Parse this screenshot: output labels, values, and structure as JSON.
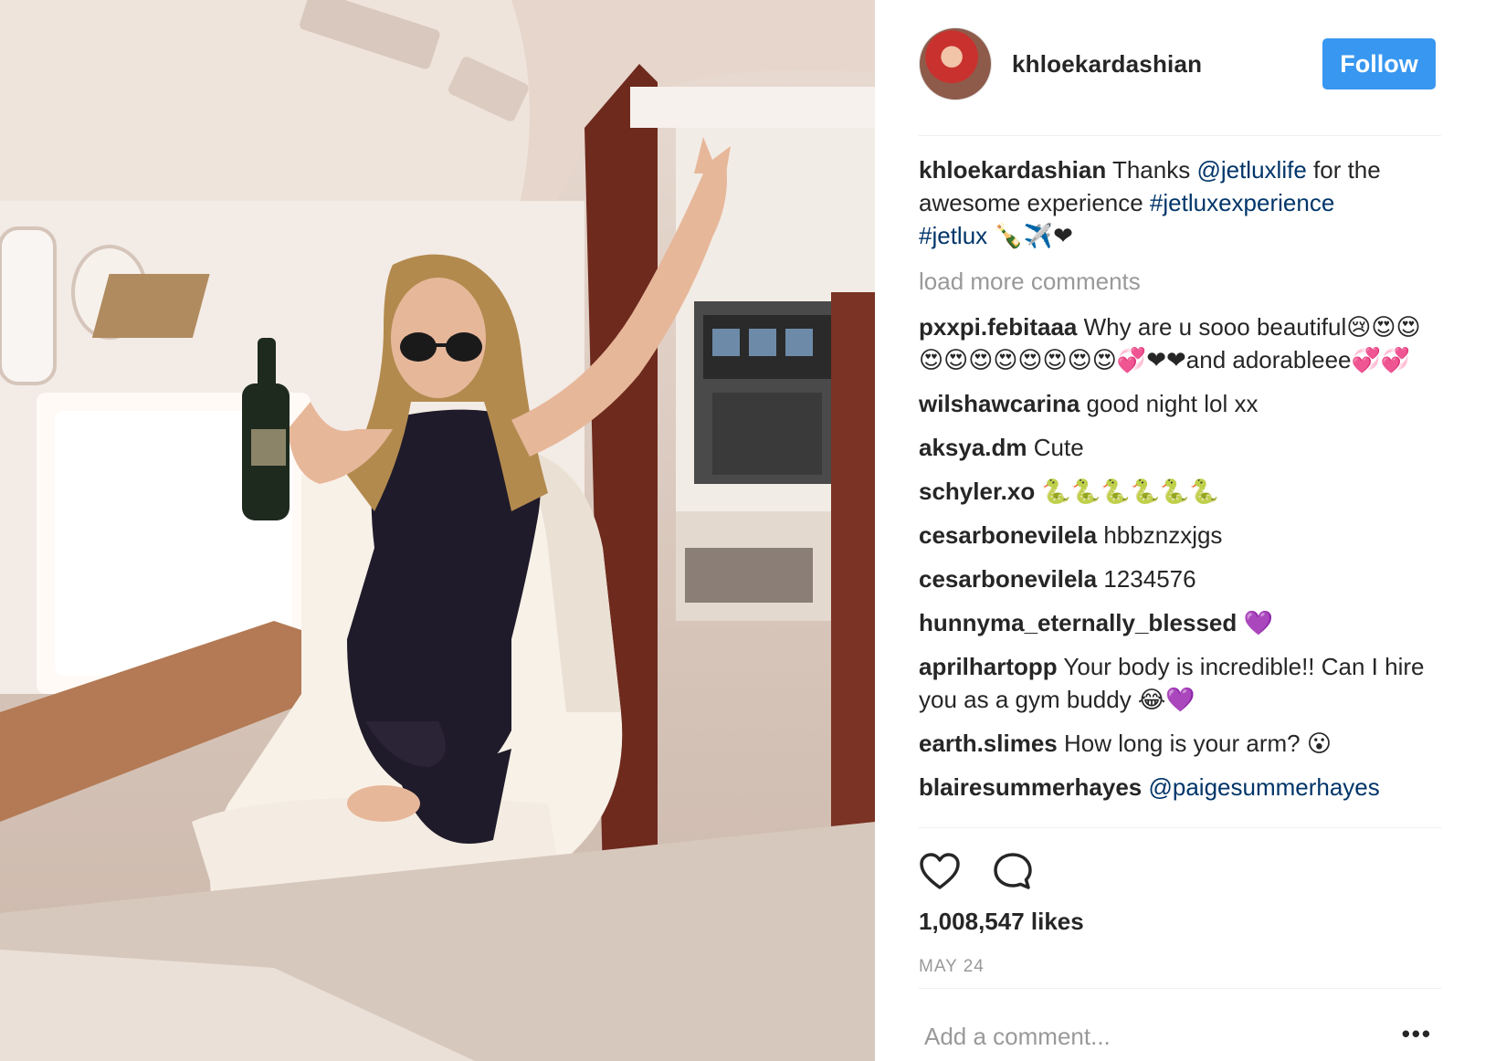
{
  "post": {
    "username": "khloekardashian",
    "follow_label": "Follow",
    "caption": {
      "user": "khloekardashian",
      "text_1": " Thanks ",
      "mention": "@jetluxlife",
      "text_2": " for the awesome experience ",
      "hashtag_1": "#jetluxexperience",
      "hashtag_2": "#jetlux",
      "emoji": " 🍾✈️❤"
    },
    "load_more_label": "load more comments",
    "comments": [
      {
        "user": "pxxpi.febitaaa",
        "text": " Why are u sooo beautiful😢😍😍😍😍😍😍😍😍😍😍💞❤❤and adorableee💞💞"
      },
      {
        "user": "wilshawcarina",
        "text": " good night lol xx"
      },
      {
        "user": "aksya.dm",
        "text": " Cute"
      },
      {
        "user": "schyler.xo",
        "text": " 🐍🐍🐍🐍🐍🐍"
      },
      {
        "user": "cesarbonevilela",
        "text": " hbbznzxjgs"
      },
      {
        "user": "cesarbonevilela",
        "text": " 1234576"
      },
      {
        "user": "hunnyma_eternally_blessed",
        "text": " 💜"
      },
      {
        "user": "aprilhartopp",
        "text": " Your body is incredible!! Can I hire you as a gym buddy 😂💜"
      },
      {
        "user": "earth.slimes",
        "text": " How long is your arm? 😮"
      },
      {
        "user": "blairesummerhayes",
        "text": " ",
        "mention": "@paigesummerhayes"
      }
    ],
    "likes_label": "1,008,547 likes",
    "date_label": "MAY 24",
    "add_comment_placeholder": "Add a comment...",
    "icons": {
      "like": "heart-icon",
      "comment": "comment-icon",
      "more": "more-options-icon"
    },
    "colors": {
      "follow_button": "#3897f0",
      "link": "#003569",
      "muted": "#999999",
      "text": "#262626"
    }
  }
}
